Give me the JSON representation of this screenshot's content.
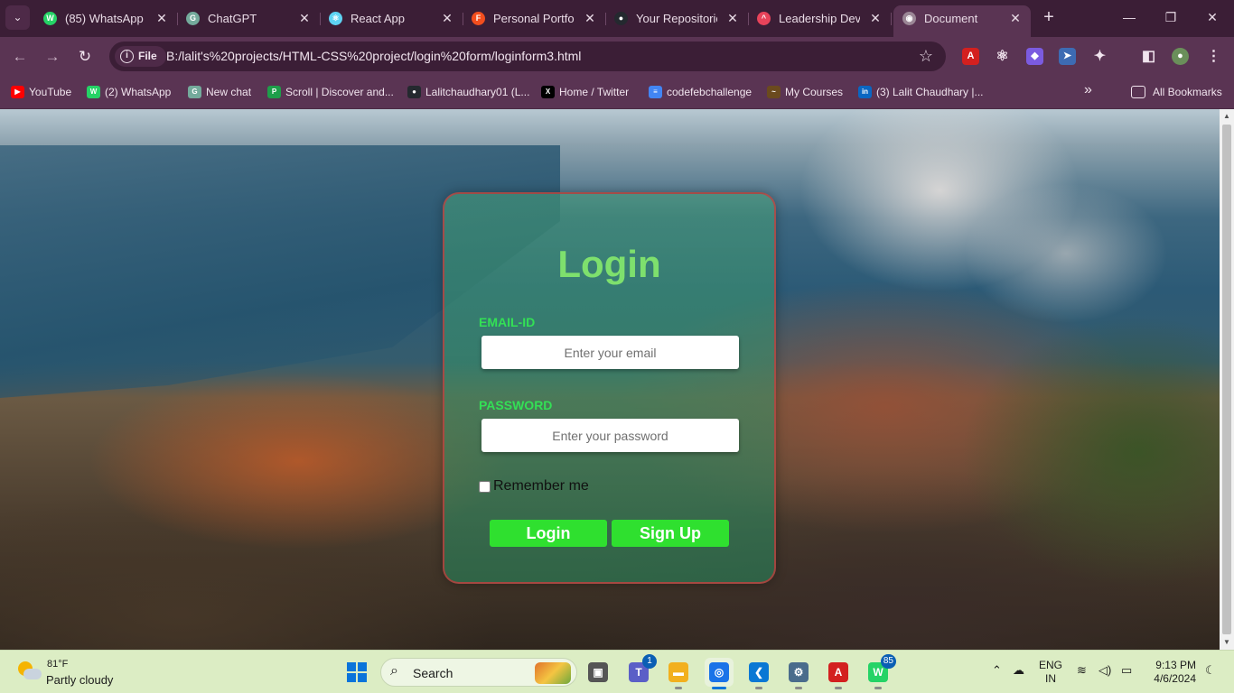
{
  "browser": {
    "tabs": [
      {
        "title": "(85) WhatsApp",
        "icon": "whatsapp-icon",
        "color": "#25d366",
        "glyph": "W"
      },
      {
        "title": "ChatGPT",
        "icon": "chatgpt-icon",
        "color": "#74aa9c",
        "glyph": "G"
      },
      {
        "title": "React App",
        "icon": "react-icon",
        "color": "#5ed3f3",
        "glyph": "⚛"
      },
      {
        "title": "Personal Portfoli",
        "icon": "figma-icon",
        "color": "#f24e1e",
        "glyph": "F"
      },
      {
        "title": "Your Repositorie",
        "icon": "github-icon",
        "color": "#24292f",
        "glyph": "●"
      },
      {
        "title": "Leadership Deve",
        "icon": "leadership-icon",
        "color": "#e8435a",
        "glyph": "^"
      },
      {
        "title": "Document",
        "icon": "globe-icon",
        "color": "#9b8796",
        "glyph": "◉"
      }
    ],
    "url_chip": "File",
    "url": "B:/lalit's%20projects/HTML-CSS%20project/login%20form/loginform3.html",
    "bookmarks": [
      {
        "label": "YouTube",
        "icon": "youtube-icon",
        "color": "#ff0000",
        "glyph": "▶"
      },
      {
        "label": "(2) WhatsApp",
        "icon": "whatsapp-icon",
        "color": "#25d366",
        "glyph": "W"
      },
      {
        "label": "New chat",
        "icon": "chatgpt-icon",
        "color": "#74aa9c",
        "glyph": "G"
      },
      {
        "label": "Scroll | Discover and...",
        "icon": "scroll-icon",
        "color": "#1e9e4a",
        "glyph": "P"
      },
      {
        "label": "Lalitchaudhary01 (L...",
        "icon": "github-icon",
        "color": "#24292f",
        "glyph": "●"
      },
      {
        "label": "Home / Twitter",
        "icon": "x-icon",
        "color": "#000000",
        "glyph": "X"
      },
      {
        "label": "codefebchallenge",
        "icon": "docs-icon",
        "color": "#4285f4",
        "glyph": "≡"
      },
      {
        "label": "My Courses",
        "icon": "courses-icon",
        "color": "#6b4a1e",
        "glyph": "~"
      },
      {
        "label": "(3) Lalit Chaudhary |...",
        "icon": "linkedin-icon",
        "color": "#0a66c2",
        "glyph": "in"
      }
    ],
    "more_bookmarks": "»",
    "all_bookmarks": "All Bookmarks"
  },
  "login": {
    "title": "Login",
    "email_label": "EMAIL-ID",
    "email_placeholder": "Enter your email",
    "password_label": "PASSWORD",
    "password_placeholder": "Enter your password",
    "remember_label": "Remember me",
    "login_button": "Login",
    "signup_button": "Sign Up"
  },
  "taskbar": {
    "weather_temp": "81°F",
    "weather_desc": "Partly cloudy",
    "search_label": "Search",
    "apps": [
      {
        "name": "task-view",
        "icon": "task-view-icon",
        "color": "#555555",
        "glyph": "▣"
      },
      {
        "name": "teams",
        "icon": "teams-icon",
        "color": "#5b5fc7",
        "glyph": "T",
        "badge": "1"
      },
      {
        "name": "file-explorer",
        "icon": "folder-icon",
        "color": "#f2b01e",
        "glyph": "▬"
      },
      {
        "name": "chrome",
        "icon": "chrome-icon",
        "color": "#1a73e8",
        "glyph": "◎",
        "active": true
      },
      {
        "name": "vscode",
        "icon": "vscode-icon",
        "color": "#0a78d4",
        "glyph": "❮"
      },
      {
        "name": "settings",
        "icon": "gear-icon",
        "color": "#4a6c8c",
        "glyph": "⚙"
      },
      {
        "name": "acrobat",
        "icon": "acrobat-icon",
        "color": "#d3201f",
        "glyph": "A"
      },
      {
        "name": "whatsapp",
        "icon": "whatsapp-icon",
        "color": "#25d366",
        "glyph": "W",
        "badge": "85"
      }
    ],
    "lang_top": "ENG",
    "lang_bottom": "IN",
    "time": "9:13 PM",
    "date": "4/6/2024"
  }
}
